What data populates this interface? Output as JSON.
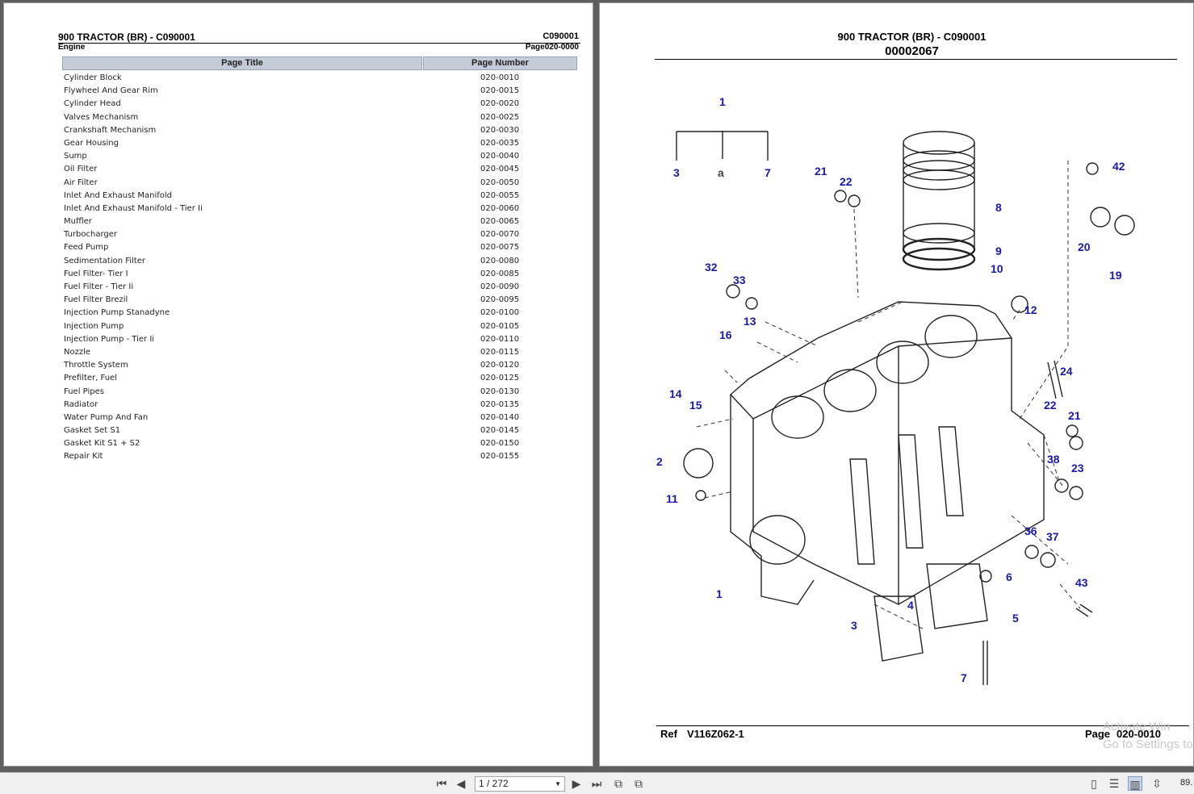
{
  "left_page": {
    "title": "900 TRACTOR (BR) - C090001",
    "code": "C090001",
    "section": "Engine",
    "page_ref": "Page020-0000",
    "col_title": "Page Title",
    "col_number": "Page Number",
    "rows": [
      {
        "title": "Cylinder Block",
        "number": "020-0010"
      },
      {
        "title": "Flywheel And Gear Rim",
        "number": "020-0015"
      },
      {
        "title": "Cylinder Head",
        "number": "020-0020"
      },
      {
        "title": "Valves Mechanism",
        "number": "020-0025"
      },
      {
        "title": "Crankshaft Mechanism",
        "number": "020-0030"
      },
      {
        "title": "Gear Housing",
        "number": "020-0035"
      },
      {
        "title": "Sump",
        "number": "020-0040"
      },
      {
        "title": "Oil Filter",
        "number": "020-0045"
      },
      {
        "title": "Air Filter",
        "number": "020-0050"
      },
      {
        "title": "Inlet And Exhaust Manifold",
        "number": "020-0055"
      },
      {
        "title": "Inlet And Exhaust Manifold - Tier Ii",
        "number": "020-0060"
      },
      {
        "title": "Muffler",
        "number": "020-0065"
      },
      {
        "title": "Turbocharger",
        "number": "020-0070"
      },
      {
        "title": "Feed Pump",
        "number": "020-0075"
      },
      {
        "title": "Sedimentation Filter",
        "number": "020-0080"
      },
      {
        "title": "Fuel Filter- Tier I",
        "number": "020-0085"
      },
      {
        "title": "Fuel Filter - Tier Ii",
        "number": "020-0090"
      },
      {
        "title": "Fuel Filter Brezil",
        "number": "020-0095"
      },
      {
        "title": "Injection Pump Stanadyne",
        "number": "020-0100"
      },
      {
        "title": "Injection Pump",
        "number": "020-0105"
      },
      {
        "title": "Injection Pump - Tier Ii",
        "number": "020-0110"
      },
      {
        "title": "Nozzle",
        "number": "020-0115"
      },
      {
        "title": "Throttle System",
        "number": "020-0120"
      },
      {
        "title": "Prefilter, Fuel",
        "number": "020-0125"
      },
      {
        "title": "Fuel Pipes",
        "number": "020-0130"
      },
      {
        "title": "Radiator",
        "number": "020-0135"
      },
      {
        "title": "Water Pump And Fan",
        "number": "020-0140"
      },
      {
        "title": "Gasket Set S1",
        "number": "020-0145"
      },
      {
        "title": "Gasket Kit S1 + S2",
        "number": "020-0150"
      },
      {
        "title": "Repair Kit",
        "number": "020-0155"
      }
    ]
  },
  "right_page": {
    "title": "900 TRACTOR (BR) - C090001",
    "doc_number": "00002067",
    "ref_label": "Ref",
    "ref_value": "V116Z062-1",
    "page_label": "Page",
    "page_value": "020-0010",
    "callouts": [
      "1",
      "3",
      "a",
      "7",
      "21",
      "22",
      "8",
      "9",
      "10",
      "42",
      "20",
      "19",
      "32",
      "33",
      "13",
      "12",
      "16",
      "24",
      "14",
      "15",
      "22",
      "21",
      "2",
      "38",
      "23",
      "11",
      "36",
      "37",
      "6",
      "43",
      "1",
      "4",
      "3",
      "5",
      "7"
    ],
    "watermark_line1": "Activate Win",
    "watermark_line2": "Go to Settings to"
  },
  "toolbar": {
    "page_indicator": "1 / 272",
    "zoom": "89.",
    "icons": [
      "first-page-icon",
      "prev-page-icon",
      "next-page-icon",
      "last-page-icon",
      "copy-icon",
      "paste-icon",
      "single-page-icon",
      "continuous-icon",
      "two-page-icon",
      "scroll-icon"
    ]
  }
}
